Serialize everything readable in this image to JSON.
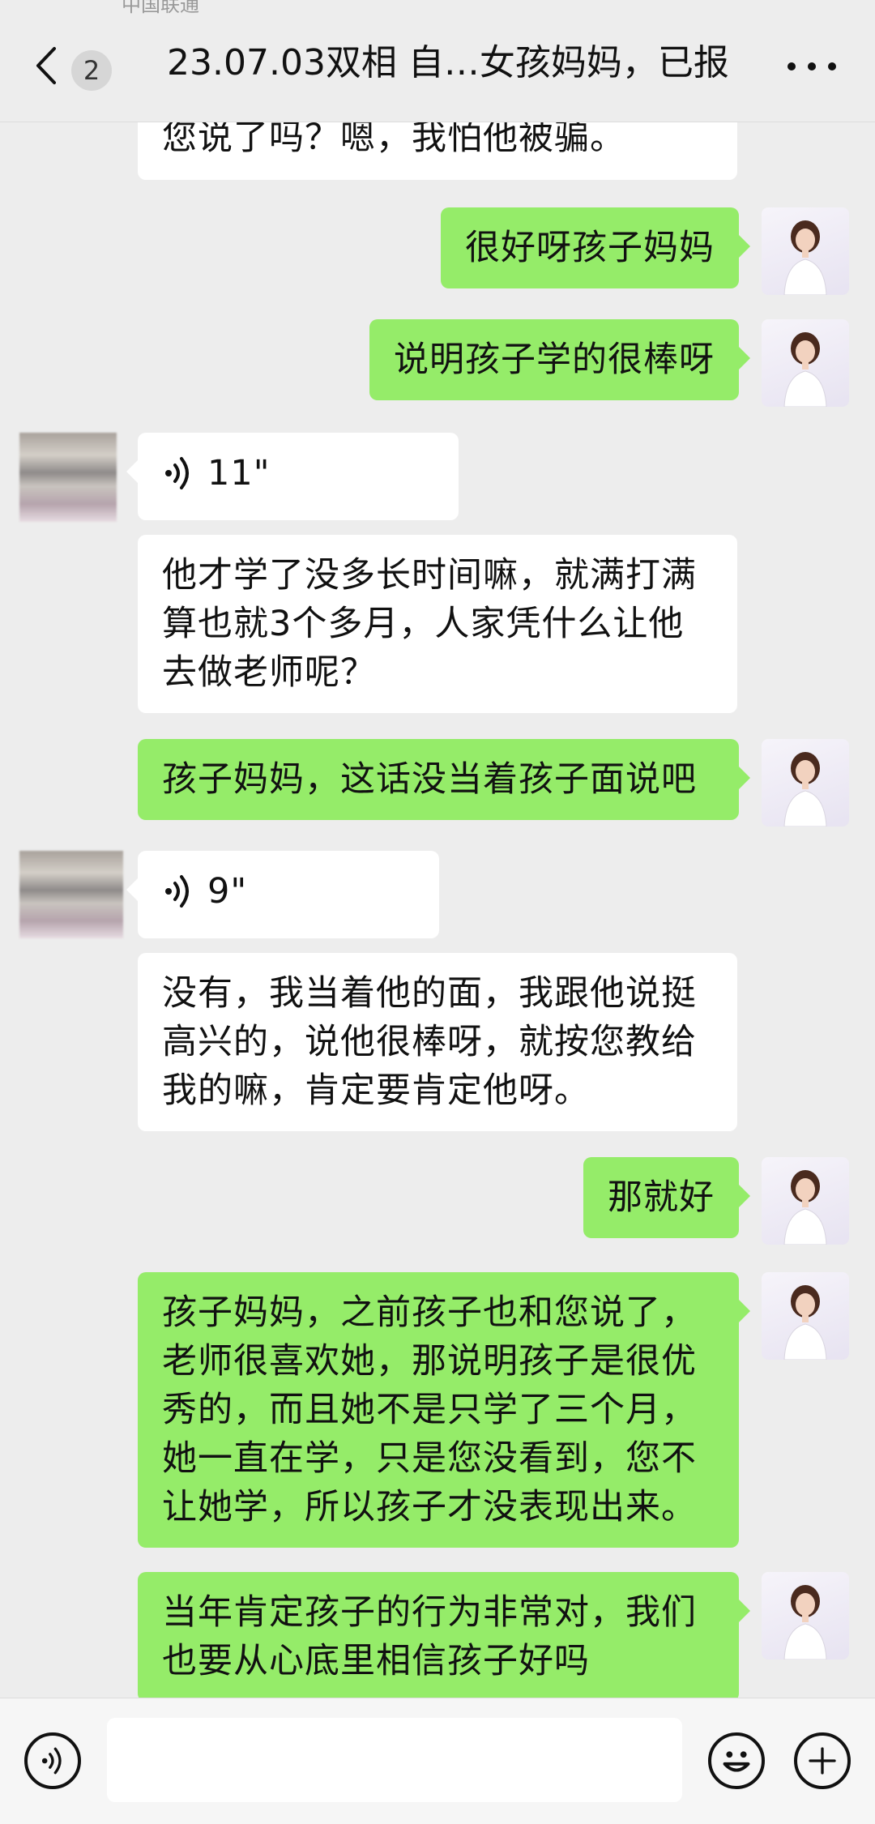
{
  "header": {
    "status_fragment": "中国联通",
    "back_label": "返回",
    "unread_count": "2",
    "title": "23.07.03双相 自…女孩妈妈，已报",
    "more_label": "更多"
  },
  "messages": [
    {
      "side": "in",
      "type": "text",
      "text": "您说了吗？嗯，我怕他被骗。"
    },
    {
      "side": "out",
      "type": "text",
      "text": "很好呀孩子妈妈"
    },
    {
      "side": "out",
      "type": "text",
      "text": "说明孩子学的很棒呀"
    },
    {
      "side": "in",
      "type": "voice",
      "duration": "11\""
    },
    {
      "side": "in",
      "type": "text",
      "text": "他才学了没多长时间嘛，就满打满算也就3个多月，人家凭什么让他去做老师呢？"
    },
    {
      "side": "out",
      "type": "text",
      "text": "孩子妈妈，这话没当着孩子面说吧"
    },
    {
      "side": "in",
      "type": "voice",
      "duration": "9\""
    },
    {
      "side": "in",
      "type": "text",
      "text": "没有，我当着他的面，我跟他说挺高兴的，说他很棒呀，就按您教给我的嘛，肯定要肯定他呀。"
    },
    {
      "side": "out",
      "type": "text",
      "text": "那就好"
    },
    {
      "side": "out",
      "type": "text",
      "text": "孩子妈妈，之前孩子也和您说了，老师很喜欢她，那说明孩子是很优秀的，而且她不是只学了三个月，她一直在学，只是您没看到，您不让她学，所以孩子才没表现出来。"
    },
    {
      "side": "out",
      "type": "text",
      "text": "当年肯定孩子的行为非常对，我们也要从心底里相信孩子好吗"
    }
  ],
  "composer": {
    "input_value": "",
    "voice_icon": "voice-input-icon",
    "emoji_icon": "emoji-icon",
    "plus_icon": "plus-icon"
  },
  "colors": {
    "background": "#ededed",
    "outgoing_bubble": "#95ec69",
    "incoming_bubble": "#ffffff"
  }
}
